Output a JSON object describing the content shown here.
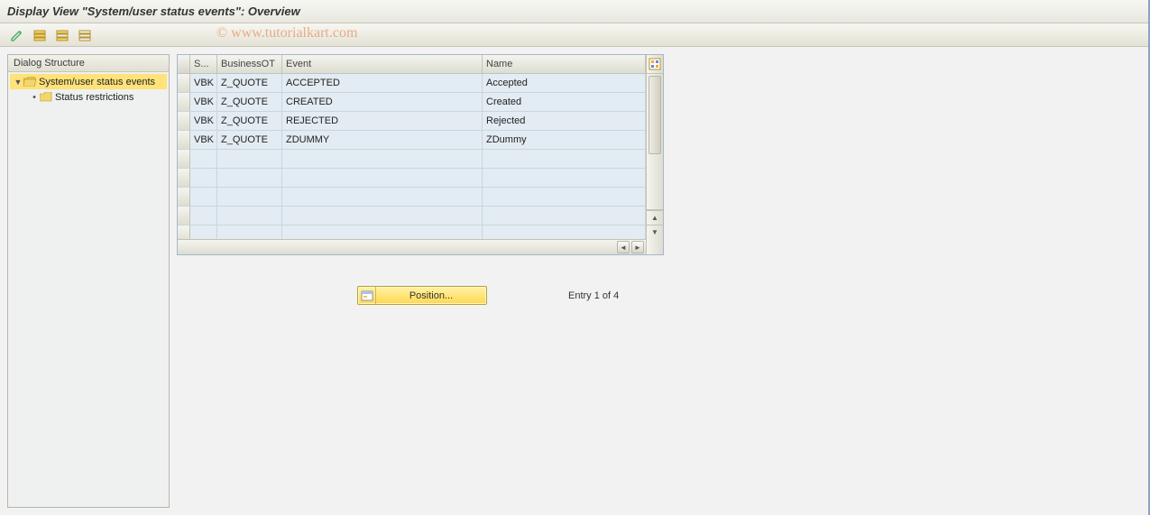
{
  "header": {
    "title": "Display View \"System/user status events\": Overview"
  },
  "watermark": "© www.tutorialkart.com",
  "toolbar": {
    "display_change": "Display/Change",
    "select_all": "Select All",
    "select_block": "Select Block",
    "deselect_all": "Deselect All"
  },
  "tree": {
    "header": "Dialog Structure",
    "items": [
      {
        "label": "System/user status events",
        "expanded": true,
        "selected": true,
        "hasChildren": true
      },
      {
        "label": "Status restrictions",
        "expanded": false,
        "selected": false,
        "hasChildren": false
      }
    ]
  },
  "grid": {
    "columns": [
      "S...",
      "BusinessOT",
      "Event",
      "Name"
    ],
    "rows": [
      {
        "s": "VBK",
        "bot": "Z_QUOTE",
        "event": "ACCEPTED",
        "name": "Accepted"
      },
      {
        "s": "VBK",
        "bot": "Z_QUOTE",
        "event": "CREATED",
        "name": "Created"
      },
      {
        "s": "VBK",
        "bot": "Z_QUOTE",
        "event": "REJECTED",
        "name": "Rejected"
      },
      {
        "s": "VBK",
        "bot": "Z_QUOTE",
        "event": "ZDUMMY",
        "name": "ZDummy"
      }
    ],
    "emptyRows": 5
  },
  "footer": {
    "position_label": "Position...",
    "entry_text": "Entry 1 of 4"
  }
}
